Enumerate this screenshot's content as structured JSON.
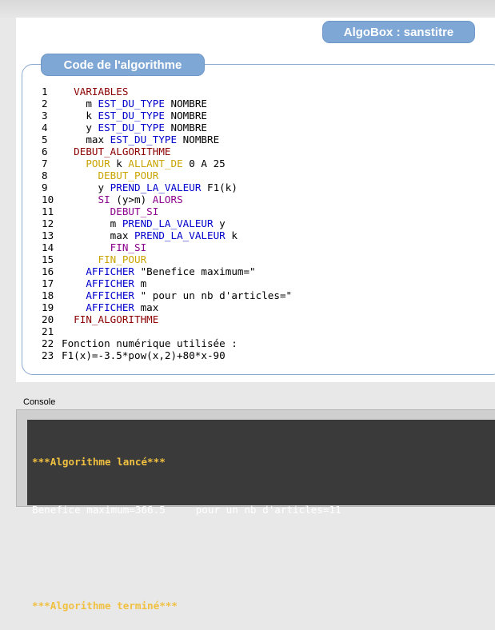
{
  "window": {
    "title": "AlgoBox : sanstitre"
  },
  "code_panel": {
    "header": "Code de l'algorithme",
    "lines": [
      {
        "n": "1",
        "parts": [
          [
            "kw-var",
            "  VARIABLES"
          ]
        ]
      },
      {
        "n": "2",
        "parts": [
          [
            "",
            "    m "
          ],
          [
            "kw-blue",
            "EST_DU_TYPE"
          ],
          [
            "",
            " NOMBRE"
          ]
        ]
      },
      {
        "n": "3",
        "parts": [
          [
            "",
            "    k "
          ],
          [
            "kw-blue",
            "EST_DU_TYPE"
          ],
          [
            "",
            " NOMBRE"
          ]
        ]
      },
      {
        "n": "4",
        "parts": [
          [
            "",
            "    y "
          ],
          [
            "kw-blue",
            "EST_DU_TYPE"
          ],
          [
            "",
            " NOMBRE"
          ]
        ]
      },
      {
        "n": "5",
        "parts": [
          [
            "",
            "    max "
          ],
          [
            "kw-blue",
            "EST_DU_TYPE"
          ],
          [
            "",
            " NOMBRE"
          ]
        ]
      },
      {
        "n": "6",
        "parts": [
          [
            "kw-darkred",
            "  DEBUT_ALGORITHME"
          ]
        ]
      },
      {
        "n": "7",
        "parts": [
          [
            "kw-gold",
            "    POUR"
          ],
          [
            "",
            " k "
          ],
          [
            "kw-gold",
            "ALLANT_DE"
          ],
          [
            "",
            " 0 A 25"
          ]
        ]
      },
      {
        "n": "8",
        "parts": [
          [
            "kw-gold",
            "      DEBUT_POUR"
          ]
        ]
      },
      {
        "n": "9",
        "parts": [
          [
            "",
            "      y "
          ],
          [
            "kw-blue",
            "PREND_LA_VALEUR"
          ],
          [
            "",
            " F1(k)"
          ]
        ]
      },
      {
        "n": "10",
        "parts": [
          [
            "kw-purple",
            "      SI"
          ],
          [
            "",
            " (y>m) "
          ],
          [
            "kw-purple",
            "ALORS"
          ]
        ]
      },
      {
        "n": "11",
        "parts": [
          [
            "kw-purple",
            "        DEBUT_SI"
          ]
        ]
      },
      {
        "n": "12",
        "parts": [
          [
            "",
            "        m "
          ],
          [
            "kw-blue",
            "PREND_LA_VALEUR"
          ],
          [
            "",
            " y"
          ]
        ]
      },
      {
        "n": "13",
        "parts": [
          [
            "",
            "        max "
          ],
          [
            "kw-blue",
            "PREND_LA_VALEUR"
          ],
          [
            "",
            " k"
          ]
        ]
      },
      {
        "n": "14",
        "parts": [
          [
            "kw-purple",
            "        FIN_SI"
          ]
        ]
      },
      {
        "n": "15",
        "parts": [
          [
            "kw-gold",
            "      FIN_POUR"
          ]
        ]
      },
      {
        "n": "16",
        "parts": [
          [
            "kw-blue",
            "    AFFICHER"
          ],
          [
            "",
            " \"Benefice maximum=\""
          ]
        ]
      },
      {
        "n": "17",
        "parts": [
          [
            "kw-blue",
            "    AFFICHER"
          ],
          [
            "",
            " m"
          ]
        ]
      },
      {
        "n": "18",
        "parts": [
          [
            "kw-blue",
            "    AFFICHER"
          ],
          [
            "",
            " \" pour un nb d'articles=\""
          ]
        ]
      },
      {
        "n": "19",
        "parts": [
          [
            "kw-blue",
            "    AFFICHER"
          ],
          [
            "",
            " max"
          ]
        ]
      },
      {
        "n": "20",
        "parts": [
          [
            "kw-darkred",
            "  FIN_ALGORITHME"
          ]
        ]
      },
      {
        "n": "21",
        "parts": [
          [
            "",
            ""
          ]
        ]
      },
      {
        "n": "22",
        "parts": [
          [
            "",
            "Fonction numérique utilisée :"
          ]
        ]
      },
      {
        "n": "23",
        "parts": [
          [
            "",
            "F1(x)=-3.5*pow(x,2)+80*x-90"
          ]
        ]
      }
    ]
  },
  "console": {
    "label": "Console",
    "start": "***Algorithme lancé***",
    "output": "Benefice maximum=366.5     pour un nb d'articles=11",
    "end": "***Algorithme terminé***"
  },
  "colors": {
    "badge": "#7fa7d5",
    "variables": "#8b0000",
    "instruction": "#0000cc",
    "loop": "#c9a400",
    "condition": "#8b008b",
    "console_bg": "#3a3a3a",
    "console_status": "#f0c040"
  }
}
